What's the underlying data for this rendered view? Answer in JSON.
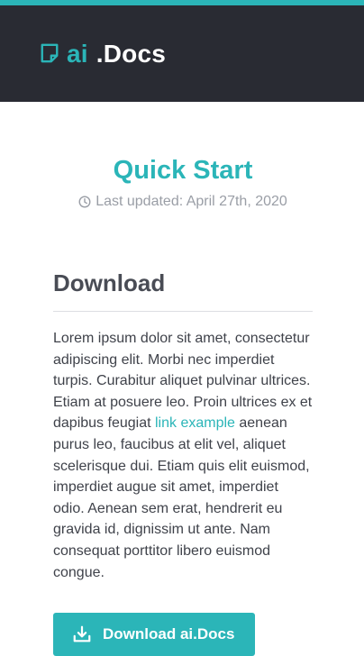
{
  "header": {
    "logo_ai": "ai",
    "logo_docs": ".Docs"
  },
  "page": {
    "title": "Quick Start",
    "last_updated": "Last updated: April 27th, 2020"
  },
  "section": {
    "title": "Download",
    "text_before_link": "Lorem ipsum dolor sit amet, consectetur adipiscing elit. Morbi nec imperdiet turpis. Curabitur aliquet pulvinar ultrices. Etiam at posuere leo. Proin ultrices ex et dapibus feugiat ",
    "link_text": "link example",
    "text_after_link": " aenean purus leo, faucibus at elit vel, aliquet scelerisque dui. Etiam quis elit euismod, imperdiet augue sit amet, imperdiet odio. Aenean sem erat, hendrerit eu gravida id, dignissim ut ante. Nam consequat porttitor libero euismod congue.",
    "button_label": "Download ai.Docs"
  },
  "icons": {
    "logo": "document-icon",
    "meta": "clock-icon",
    "button": "download-icon"
  },
  "colors": {
    "accent": "#2bb5b8",
    "header_bg": "#292b33",
    "heading": "#494c55",
    "muted": "#9a9ea6"
  }
}
